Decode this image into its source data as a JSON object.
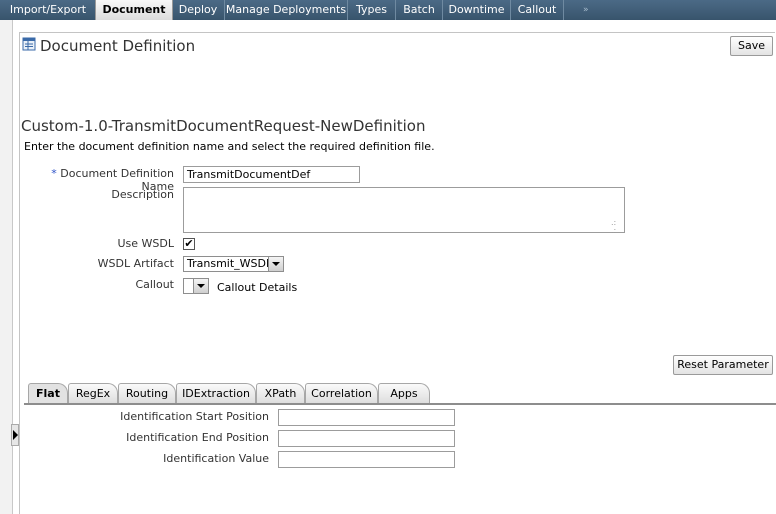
{
  "top_tabs": [
    {
      "label": "Import/Export",
      "active": false
    },
    {
      "label": "Document",
      "active": true
    },
    {
      "label": "Deploy",
      "active": false
    },
    {
      "label": "Manage Deployments",
      "active": false
    },
    {
      "label": "Types",
      "active": false
    },
    {
      "label": "Batch",
      "active": false
    },
    {
      "label": "Downtime",
      "active": false
    },
    {
      "label": "Callout",
      "active": false
    }
  ],
  "top_tabs_overflow": "»",
  "page": {
    "title": "Document Definition",
    "save_label": "Save"
  },
  "definition": {
    "heading": "Custom-1.0-TransmitDocumentRequest-NewDefinition",
    "instructions": "Enter the document definition name and select the required definition file."
  },
  "form": {
    "required_marker": "*",
    "name_label": "Document Definition Name",
    "name_value": "TransmitDocumentDef",
    "description_label": "Description",
    "description_value": "",
    "use_wsdl_label": "Use WSDL",
    "use_wsdl_checked": true,
    "use_wsdl_mark": "✔",
    "wsdl_artifact_label": "WSDL Artifact",
    "wsdl_artifact_value": "Transmit_WSDL",
    "callout_label": "Callout",
    "callout_value": "",
    "callout_details_label": "Callout Details"
  },
  "reset_parameter_label": "Reset Parameter",
  "bottom_tabs": [
    {
      "label": "Flat",
      "active": true
    },
    {
      "label": "RegEx",
      "active": false
    },
    {
      "label": "Routing",
      "active": false
    },
    {
      "label": "IDExtraction",
      "active": false
    },
    {
      "label": "XPath",
      "active": false
    },
    {
      "label": "Correlation",
      "active": false
    },
    {
      "label": "Apps",
      "active": false
    }
  ],
  "flat": {
    "start_label": "Identification Start Position",
    "start_value": "",
    "end_label": "Identification End Position",
    "end_value": "",
    "value_label": "Identification Value",
    "value_value": ""
  },
  "colors": {
    "topbar": "#4b6a86",
    "required": "#2d52c7"
  }
}
